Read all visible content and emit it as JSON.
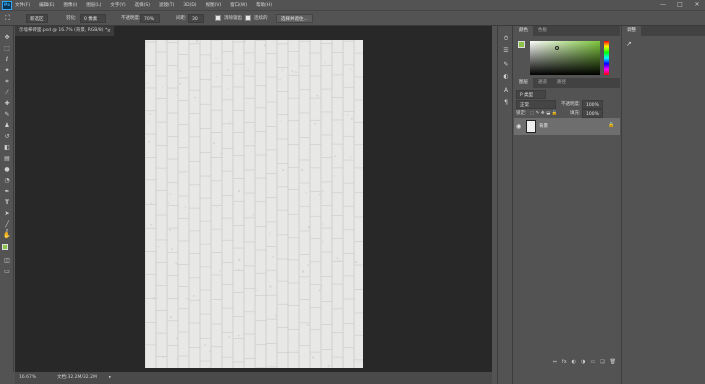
{
  "app": {
    "logo": "Ps"
  },
  "menu": [
    "文件(F)",
    "编辑(E)",
    "图像(I)",
    "图层(L)",
    "文字(Y)",
    "选择(S)",
    "滤镜(T)",
    "3D(D)",
    "视图(V)",
    "窗口(W)",
    "帮助(H)"
  ],
  "window_controls": {
    "minimize": "—",
    "maximize": "□",
    "close": "✕"
  },
  "options": {
    "tool_preset": "⛶",
    "mode": "新选区",
    "feather_label": "羽化:",
    "feather_value": "0 像素",
    "opacity_label": "不透明度:",
    "opacity_value": "70%",
    "spacing_label": "间距:",
    "spacing_value": "30",
    "check1_label": "消除锯齿",
    "check2_label": "连续的",
    "button_label": "选择并遮住..."
  },
  "document": {
    "tab_title": "示墙拳砖面.psd @ 16.7% (背景, RGB/8) *",
    "tab_close": "×"
  },
  "status": {
    "zoom": "16.67%",
    "doc_info": "文档:32.2M/32.2M",
    "arrow": "▸"
  },
  "color_panel": {
    "tabs": [
      "颜色",
      "色板"
    ],
    "fg_color": "#8bc34a"
  },
  "layers_panel": {
    "tabs": [
      "图层",
      "通道",
      "路径"
    ],
    "kind_filter": "P 类型",
    "blend_mode": "正常",
    "opacity_label": "不透明度:",
    "opacity_value": "100%",
    "lock_label": "锁定:",
    "fill_label": "填充:",
    "fill_value": "100%",
    "layer_name": "背景",
    "footer_icons": [
      "⇔",
      "fx",
      "◐",
      "◑",
      "▭",
      "❏",
      "🗑"
    ]
  },
  "adjust_panel": {
    "tabs": [
      "调整"
    ]
  }
}
